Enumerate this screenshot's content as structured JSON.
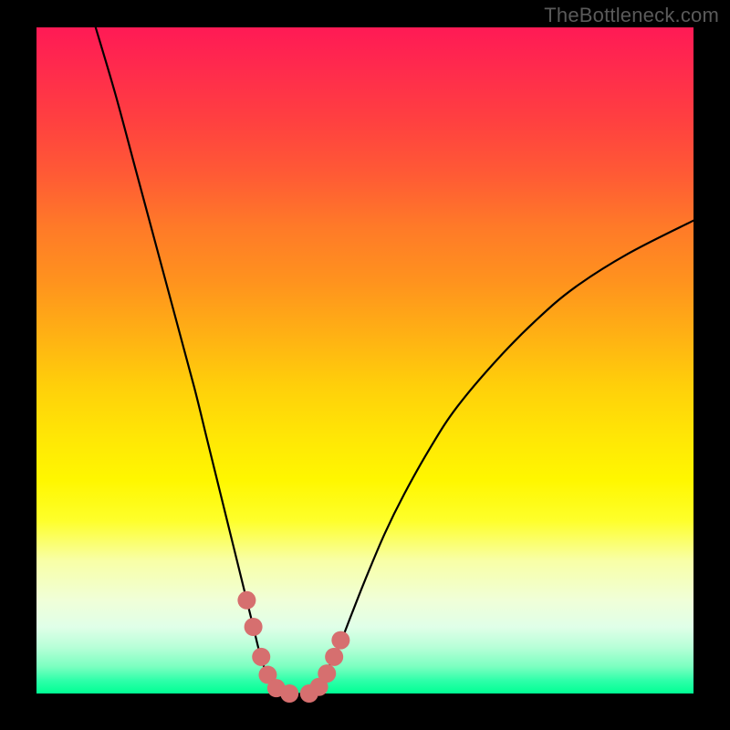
{
  "watermark": "TheBottleneck.com",
  "colors": {
    "background": "#000000",
    "curve": "#000000",
    "dotFill": "#d66f6f",
    "dotStroke": "#cc5a5a",
    "gradient_top": "#ff1a55",
    "gradient_bottom": "#00ff94"
  },
  "chart_data": {
    "type": "line",
    "title": "",
    "xlabel": "",
    "ylabel": "",
    "xlim": [
      0,
      100
    ],
    "ylim": [
      0,
      100
    ],
    "grid": false,
    "legend": false,
    "series": [
      {
        "name": "left-curve",
        "x": [
          9,
          12,
          15,
          18,
          21,
          24,
          26,
          28,
          30,
          32,
          33,
          34,
          35,
          36,
          37
        ],
        "y": [
          100,
          90,
          79,
          68,
          57,
          46,
          38,
          30,
          22,
          14,
          10,
          6,
          3,
          1,
          0
        ]
      },
      {
        "name": "right-curve",
        "x": [
          42,
          43,
          44,
          46,
          48,
          50,
          53,
          56,
          60,
          64,
          70,
          76,
          82,
          90,
          100
        ],
        "y": [
          0,
          1,
          3,
          7,
          12,
          17,
          24,
          30,
          37,
          43,
          50,
          56,
          61,
          66,
          71
        ]
      },
      {
        "name": "valley-floor",
        "x": [
          37,
          42
        ],
        "y": [
          0,
          0
        ]
      }
    ],
    "dots": {
      "name": "highlight-dots",
      "x": [
        32.0,
        33.0,
        34.2,
        35.2,
        36.5,
        38.5,
        41.5,
        43.0,
        44.2,
        45.3,
        46.3
      ],
      "y": [
        14.0,
        10.0,
        5.5,
        2.8,
        0.8,
        0.0,
        0.0,
        1.0,
        3.0,
        5.5,
        8.0
      ]
    },
    "dot_radius_px": 10
  }
}
